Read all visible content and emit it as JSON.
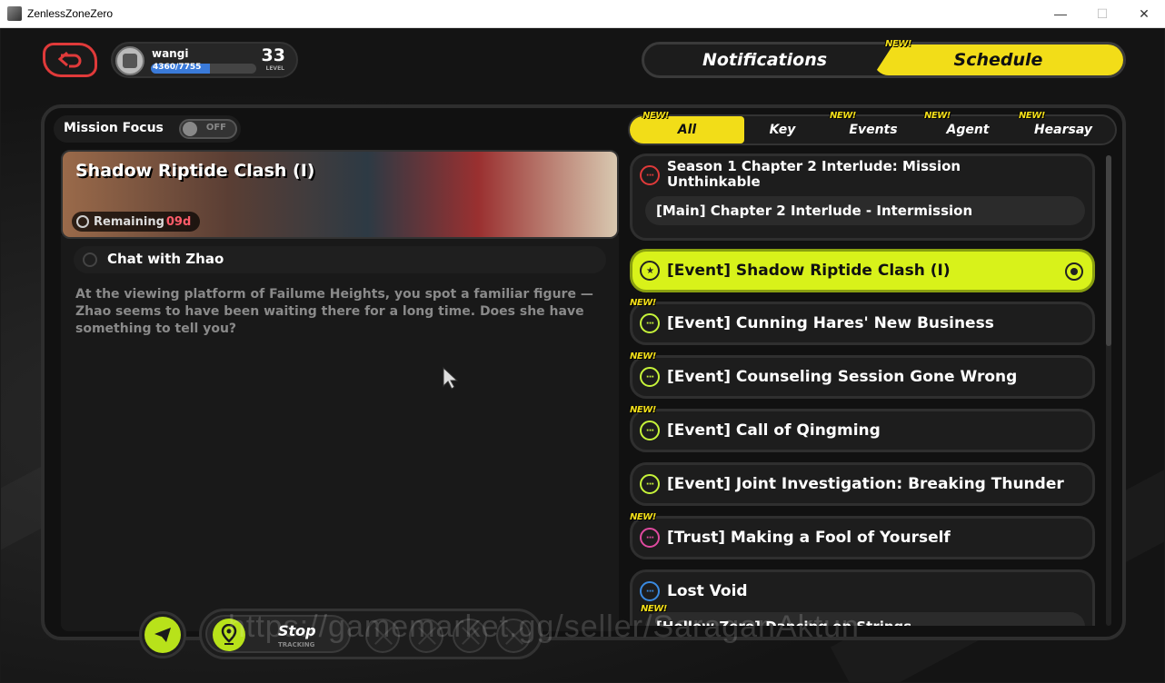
{
  "window": {
    "title": "ZenlessZoneZero",
    "minimize": "—",
    "maximize": "☐",
    "close": "✕"
  },
  "profile": {
    "name": "wangi",
    "xp": "4360/7755",
    "xp_fraction": 0.562,
    "level": "33",
    "level_label": "LEVEL"
  },
  "top_tabs": {
    "notifications": "Notifications",
    "schedule": "Schedule",
    "new_tag": "NEW!"
  },
  "mission_focus": {
    "label": "Mission Focus",
    "state": "OFF"
  },
  "filter_tabs": [
    {
      "label": "All",
      "new": "NEW!"
    },
    {
      "label": "Key",
      "new": ""
    },
    {
      "label": "Events",
      "new": "NEW!"
    },
    {
      "label": "Agent",
      "new": "NEW!"
    },
    {
      "label": "Hearsay",
      "new": "NEW!"
    }
  ],
  "detail": {
    "title": "Shadow Riptide Clash (I)",
    "remaining_label": "Remaining",
    "remaining_days": "09d",
    "objective": "Chat with Zhao",
    "description": "At the viewing platform of Failume Heights, you spot a familiar figure — Zhao seems to have been waiting there for a long time. Does she have something to tell you?"
  },
  "tracking": {
    "stop": "Stop",
    "tracking_label": "TRACKING"
  },
  "quests": [
    {
      "title": "Season 1 Chapter 2 Interlude: Mission Unthinkable",
      "sub": "[Main] Chapter 2 Interlude - Intermission",
      "color": "#e03a3a",
      "new": ""
    },
    {
      "title": "[Event] Shadow Riptide Clash (I)",
      "color": "#222222",
      "new": ""
    },
    {
      "title": "[Event] Cunning Hares' New Business",
      "color": "#c6f33a",
      "new": "NEW!"
    },
    {
      "title": "[Event] Counseling Session Gone Wrong",
      "color": "#c6f33a",
      "new": "NEW!"
    },
    {
      "title": "[Event] Call of Qingming",
      "color": "#c6f33a",
      "new": "NEW!"
    },
    {
      "title": "[Event] Joint Investigation: Breaking Thunder",
      "color": "#c6f33a",
      "new": ""
    },
    {
      "title": "[Trust] Making a Fool of Yourself",
      "color": "#e04aa0",
      "new": "NEW!"
    },
    {
      "title": "Lost Void",
      "sub": "[Hollow Zero] Dancing on Strings",
      "color": "#3a8ae0",
      "new": "",
      "sub_new": "NEW!"
    }
  ],
  "watermark": "https://gamemarket.gg/seller/SaraganAktun"
}
